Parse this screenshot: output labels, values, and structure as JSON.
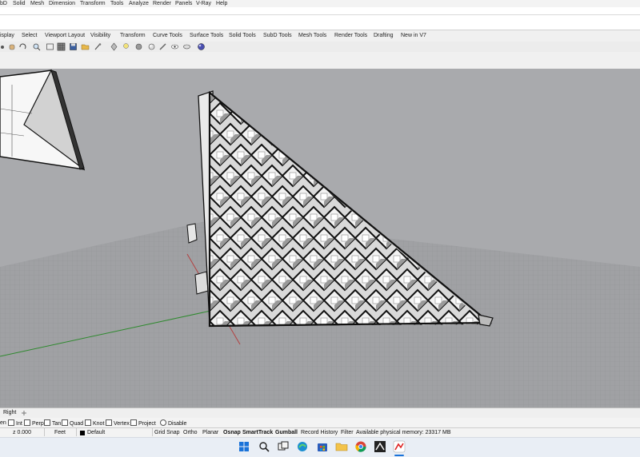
{
  "menu": {
    "items": [
      "bD",
      "Solid",
      "Mesh",
      "Dimension",
      "Transform",
      "Tools",
      "Analyze",
      "Render",
      "Panels",
      "V-Ray",
      "Help"
    ]
  },
  "tabs": [
    "isplay",
    "Select",
    "Viewport Layout",
    "Visibility",
    "Transform",
    "Curve Tools",
    "Surface Tools",
    "Solid Tools",
    "SubD Tools",
    "Mesh Tools",
    "Render Tools",
    "Drafting",
    "New in V7"
  ],
  "viewport_tabs": {
    "active": "Right",
    "add_icon": "plus-icon"
  },
  "osnaps": {
    "items": [
      {
        "label": "en",
        "checked": false,
        "kind": "partial"
      },
      {
        "label": "Int",
        "checked": false,
        "kind": "check"
      },
      {
        "label": "Perp",
        "checked": false,
        "kind": "check"
      },
      {
        "label": "Tan",
        "checked": false,
        "kind": "check"
      },
      {
        "label": "Quad",
        "checked": false,
        "kind": "check"
      },
      {
        "label": "Knot",
        "checked": false,
        "kind": "check"
      },
      {
        "label": "Vertex",
        "checked": false,
        "kind": "check"
      },
      {
        "label": "Project",
        "checked": false,
        "kind": "check"
      },
      {
        "label": "Disable",
        "checked": false,
        "kind": "radio"
      }
    ]
  },
  "status": {
    "z": "z 0.000",
    "units": "Feet",
    "layer": "Default",
    "layer_color": "#000000",
    "buttons": [
      "Grid Snap",
      "Ortho",
      "Planar",
      "Osnap",
      "SmartTrack",
      "Gumball",
      "Record History",
      "Filter"
    ],
    "bold_buttons": [
      "Osnap",
      "SmartTrack",
      "Gumball"
    ],
    "memory": "Available physical memory: 23317 MB"
  },
  "taskbar": {
    "icons": [
      "windows-start-icon",
      "search-icon",
      "task-view-icon",
      "edge-browser-icon",
      "store-icon",
      "file-explorer-icon",
      "chrome-icon",
      "app-icon",
      "rhino-icon"
    ]
  },
  "colors": {
    "viewport_bg": "#a9aaad",
    "grid": "#8f9093",
    "x_axis": "#b34040",
    "y_axis": "#2f8a2f"
  }
}
